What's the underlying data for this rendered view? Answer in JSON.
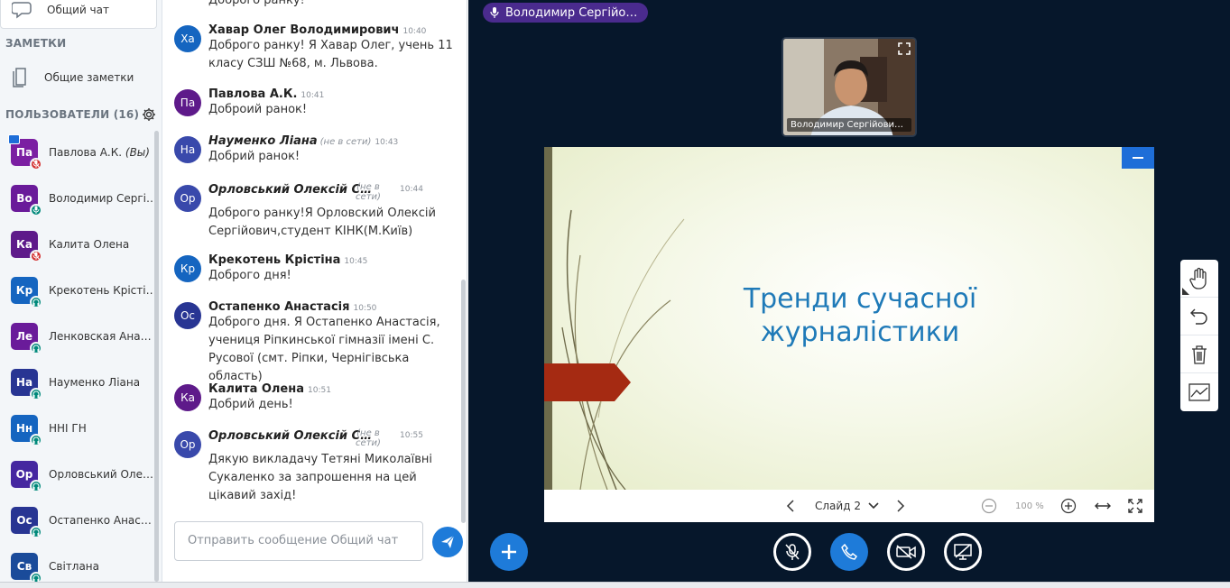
{
  "sidebar": {
    "chat_link": "Общий чат",
    "notes_title": "ЗАМЕТКИ",
    "notes_link": "Общие заметки",
    "users_title": "ПОЛЬЗОВАТЕЛИ (16)",
    "users": [
      {
        "initials": "Па",
        "name": "Павлова А.К.",
        "suffix": "(Вы)",
        "color": "#7b1fa2",
        "status": "muted",
        "presenter": true
      },
      {
        "initials": "Во",
        "name": "Володимир Сергі…",
        "suffix": "",
        "color": "#6a1b9a",
        "status": "mic",
        "presenter": false
      },
      {
        "initials": "Ка",
        "name": "Калита Олена",
        "suffix": "",
        "color": "#5e1a8a",
        "status": "muted",
        "presenter": false
      },
      {
        "initials": "Кр",
        "name": "Крекотень Крістіна",
        "suffix": "",
        "color": "#1565c0",
        "status": "listen",
        "presenter": false
      },
      {
        "initials": "Ле",
        "name": "Ленковская Анаст…",
        "suffix": "",
        "color": "#6a1b9a",
        "status": "listen",
        "presenter": false
      },
      {
        "initials": "На",
        "name": "Науменко Ліана",
        "suffix": "",
        "color": "#283593",
        "status": "listen",
        "presenter": false
      },
      {
        "initials": "Нн",
        "name": "ННІ ГН",
        "suffix": "",
        "color": "#1565c0",
        "status": "listen",
        "presenter": false
      },
      {
        "initials": "Ор",
        "name": "Орловський Олек…",
        "suffix": "",
        "color": "#4527a0",
        "status": "listen",
        "presenter": false
      },
      {
        "initials": "Ос",
        "name": "Остапенко Анаст…",
        "suffix": "",
        "color": "#283593",
        "status": "listen",
        "presenter": false
      },
      {
        "initials": "Св",
        "name": "Світлана",
        "suffix": "",
        "color": "#1a4b9a",
        "status": "listen",
        "presenter": false
      }
    ]
  },
  "chat": {
    "top_partial": "Доброго ранку!",
    "messages": [
      {
        "initials": "Ха",
        "color": "#1565c0",
        "name": "Хавар Олег Володимирович",
        "offline": "",
        "time": "10:40",
        "text": "Доброго ранку! Я Хавар Олег, учень 11 класу СЗШ №68, м. Львова."
      },
      {
        "initials": "Па",
        "color": "#5e1a8a",
        "name": "Павлова А.К.",
        "offline": "",
        "time": "10:41",
        "text": "Доброий ранок!"
      },
      {
        "initials": "На",
        "color": "#3949ab",
        "name": "Науменко Ліана",
        "offline": "(не в сети)",
        "time": "10:43",
        "text": "Добрий ранок!"
      },
      {
        "initials": "Ор",
        "color": "#3949ab",
        "name": "Орловський Олексій С…",
        "offline": "(не в сети)",
        "time": "10:44",
        "text": "Доброго ранку!Я Орловский Олексій Сергійович,студент КІНК(М.Київ)"
      },
      {
        "initials": "Кр",
        "color": "#1565c0",
        "name": "Крекотень Крістіна",
        "offline": "",
        "time": "10:45",
        "text": "Доброго дня!"
      },
      {
        "initials": "Ос",
        "color": "#283593",
        "name": "Остапенко Анастасія",
        "offline": "",
        "time": "10:50",
        "text": "Доброго дня. Я Остапенко Анастасія, учениця Ріпкинської гімназії імені С. Русової (смт. Ріпки, Чернігівська область)"
      },
      {
        "initials": "Ка",
        "color": "#5e1a8a",
        "name": "Калита Олена",
        "offline": "",
        "time": "10:51",
        "text": "Добрий день!"
      },
      {
        "initials": "Ор",
        "color": "#3949ab",
        "name": "Орловський Олексій С…",
        "offline": "(не в сети)",
        "time": "10:55",
        "text": "Дякую викладачу Тетяні Миколаївні Сукаленко за запрошення на цей цікавий захід!"
      }
    ],
    "input_placeholder": "Отправить сообщение Общий чат"
  },
  "main": {
    "talking": "Володимир Сергійо…",
    "webcam_name": "Володимир Сергійови…",
    "slide_title": "Тренди сучасної журналістики",
    "slide_label": "Слайд 2",
    "zoom": "100 %"
  },
  "colors": {
    "accent": "#1e7bd9",
    "background": "#06172b",
    "talker": "#4a2b8e",
    "muted": "#d32f2f",
    "listen": "#00897b"
  }
}
